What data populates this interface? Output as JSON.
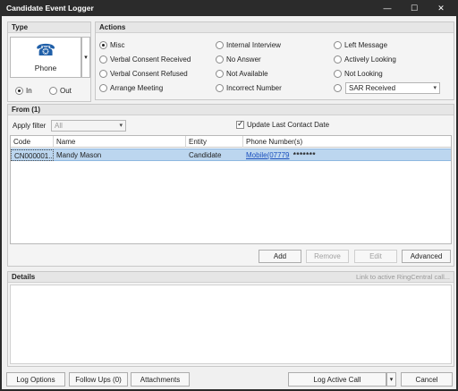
{
  "window": {
    "title": "Candidate Event Logger",
    "minimize_glyph": "—",
    "maximize_glyph": "☐",
    "close_glyph": "✕"
  },
  "type": {
    "header": "Type",
    "selected": "Phone",
    "in_label": "In",
    "out_label": "Out",
    "direction_selected": "In",
    "phone_icon_glyph": "☎"
  },
  "actions": {
    "header": "Actions",
    "items": [
      {
        "label": "Misc",
        "selected": true
      },
      {
        "label": "Verbal Consent Received",
        "selected": false
      },
      {
        "label": "Verbal Consent Refused",
        "selected": false
      },
      {
        "label": "Arrange Meeting",
        "selected": false
      },
      {
        "label": "Internal Interview",
        "selected": false
      },
      {
        "label": "No Answer",
        "selected": false
      },
      {
        "label": "Not Available",
        "selected": false
      },
      {
        "label": "Incorrect Number",
        "selected": false
      },
      {
        "label": "Left Message",
        "selected": false
      },
      {
        "label": "Actively Looking",
        "selected": false
      },
      {
        "label": "Not Looking",
        "selected": false
      }
    ],
    "sar_value": "SAR Received"
  },
  "from": {
    "header": "From (1)",
    "apply_filter_label": "Apply filter",
    "filter_value": "All",
    "update_last_contact_label": "Update Last Contact Date",
    "update_last_contact_checked": true,
    "columns": [
      "Code",
      "Name",
      "Entity",
      "Phone Number(s)"
    ],
    "rows": [
      {
        "code": "CN000001...",
        "name": "Mandy Mason",
        "entity": "Candidate",
        "phone": "Mobile(07779",
        "phone_masked": "*******"
      }
    ],
    "buttons": {
      "add": "Add",
      "remove": "Remove",
      "edit": "Edit",
      "advanced": "Advanced"
    }
  },
  "details": {
    "header": "Details",
    "link_text": "Link to active RingCentral call..."
  },
  "footer": {
    "log_options": "Log Options",
    "follow_ups": "Follow Ups (0)",
    "attachments": "Attachments",
    "log_active_call": "Log Active Call",
    "cancel": "Cancel"
  }
}
